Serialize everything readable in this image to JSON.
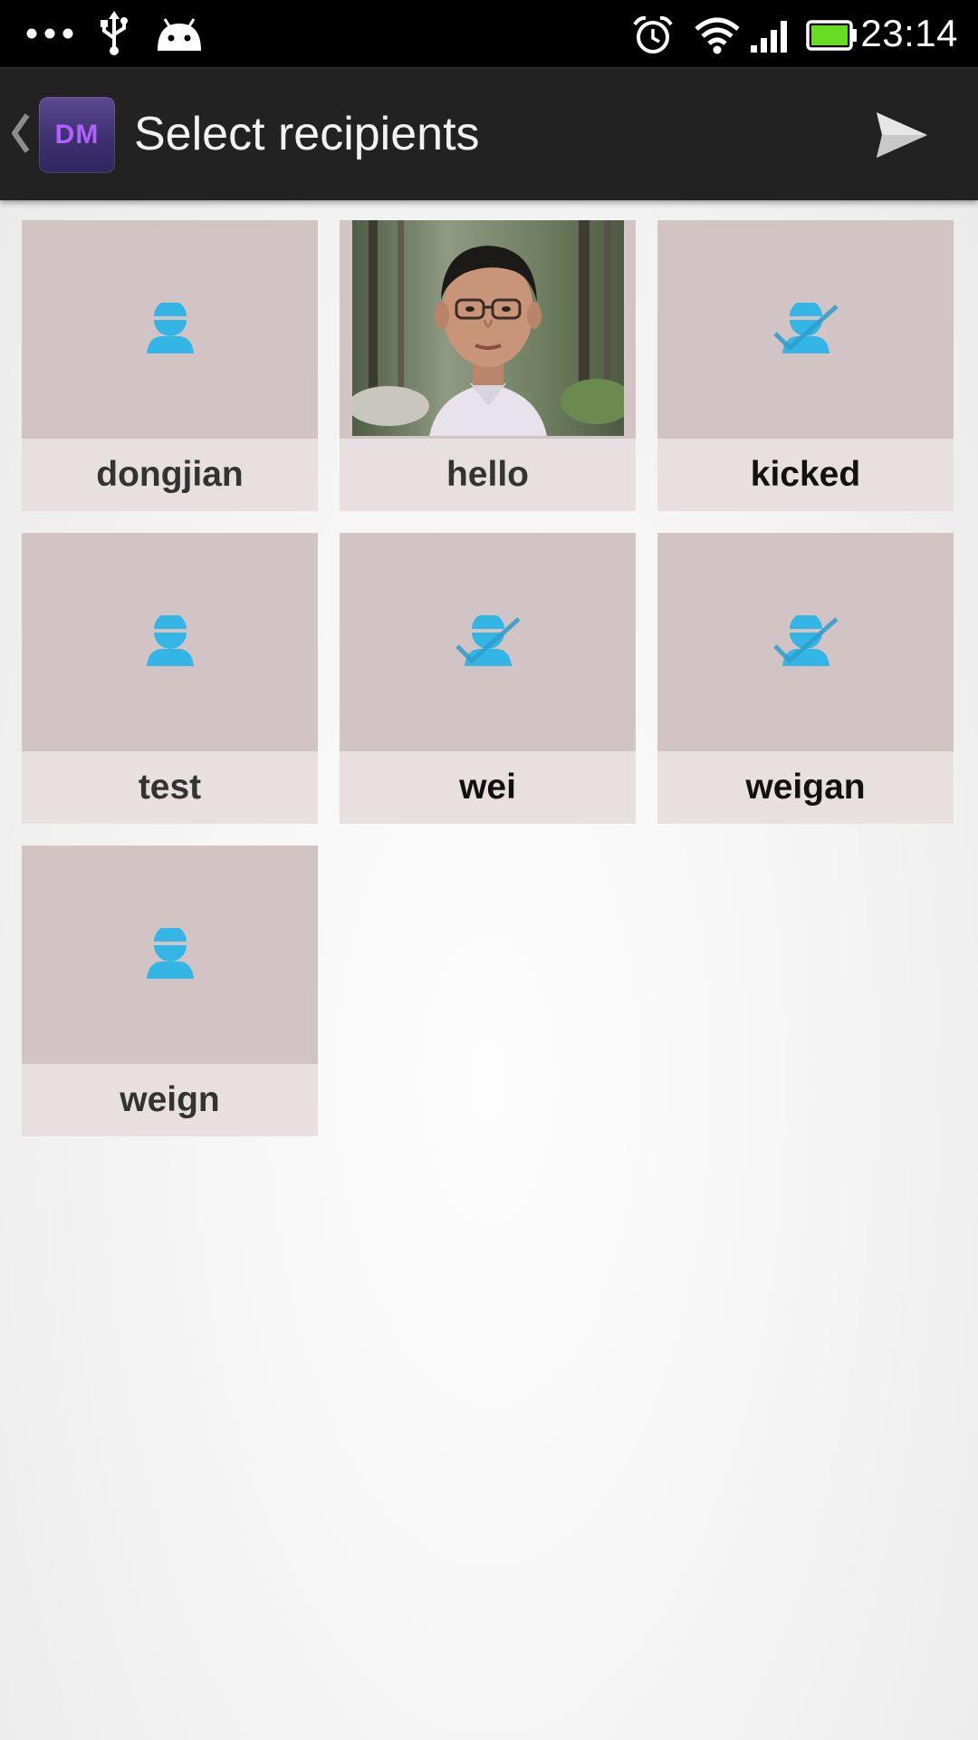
{
  "status_bar": {
    "time": "23:14",
    "left_icons": [
      "overflow-dots-icon",
      "usb-icon",
      "android-icon"
    ],
    "right_icons": [
      "alarm-clock-icon",
      "wifi-icon",
      "cell-signal-icon",
      "battery-icon"
    ]
  },
  "action_bar": {
    "logo_text": "DM",
    "title": "Select recipients",
    "send_icon": "send-icon"
  },
  "colors": {
    "accent": "#33b5e5",
    "tile_avatar_bg": "#d2c4c5",
    "tile_label_bg": "#e8dfe0",
    "action_bar": "#222222",
    "logo_text": "#b061ff",
    "battery_fill": "#66dd22"
  },
  "recipients": [
    {
      "name": "dongjian",
      "avatar": "default-person-icon"
    },
    {
      "name": "hello",
      "avatar": "photo"
    },
    {
      "name": "kicked",
      "avatar": "person-checked-icon"
    },
    {
      "name": "test",
      "avatar": "default-person-icon"
    },
    {
      "name": "wei",
      "avatar": "person-checked-icon"
    },
    {
      "name": "weigan",
      "avatar": "person-checked-icon"
    },
    {
      "name": "weign",
      "avatar": "default-person-icon"
    }
  ]
}
